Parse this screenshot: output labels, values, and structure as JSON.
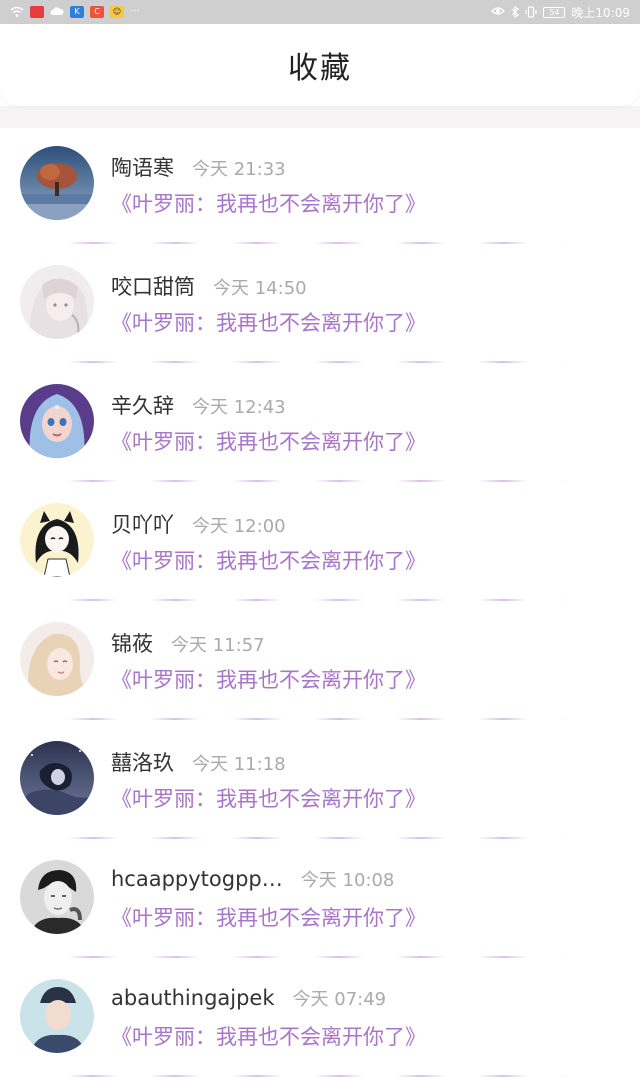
{
  "status_bar": {
    "time": "晚上10:09",
    "left_icons": [
      "wifi-icon",
      "notification-icon",
      "cloud-icon",
      "app-k-icon",
      "app-store-icon",
      "app-face-icon",
      "more-icon"
    ],
    "right_icons": [
      "eye-icon",
      "bluetooth-icon",
      "vibrate-icon",
      "battery-icon"
    ],
    "more_label": "···",
    "battery_label": "54"
  },
  "header": {
    "title": "收藏"
  },
  "favorites": [
    {
      "name": "陶语寒",
      "time": "今天 21:33",
      "quote": "《叶罗丽：我再也不会离开你了》",
      "avatar": "tree-landscape"
    },
    {
      "name": "咬口甜筒",
      "time": "今天 14:50",
      "quote": "《叶罗丽：我再也不会离开你了》",
      "avatar": "pale-anime-girl"
    },
    {
      "name": "辛久辞",
      "time": "今天 12:43",
      "quote": "《叶罗丽：我再也不会离开你了》",
      "avatar": "doll-blue-hair"
    },
    {
      "name": "贝吖吖",
      "time": "今天 12:00",
      "quote": "《叶罗丽：我再也不会离开你了》",
      "avatar": "cat-ear-girl"
    },
    {
      "name": "锦莜",
      "time": "今天 11:57",
      "quote": "《叶罗丽：我再也不会离开你了》",
      "avatar": "blonde-illustration"
    },
    {
      "name": "囍洛玖",
      "time": "今天 11:18",
      "quote": "《叶罗丽：我再也不会离开你了》",
      "avatar": "dark-night-scene"
    },
    {
      "name": "hcaappytogpp…",
      "time": "今天 10:08",
      "quote": "《叶罗丽：我再也不会离开你了》",
      "avatar": "bw-portrait"
    },
    {
      "name": "abauthingajpek",
      "time": "今天 07:49",
      "quote": "《叶罗丽：我再也不会离开你了》",
      "avatar": "boy-cap"
    }
  ],
  "colors": {
    "quote": "#a876c8",
    "name": "#333333",
    "time": "#aaaaaa",
    "status_bar": "#cfcfcf"
  }
}
